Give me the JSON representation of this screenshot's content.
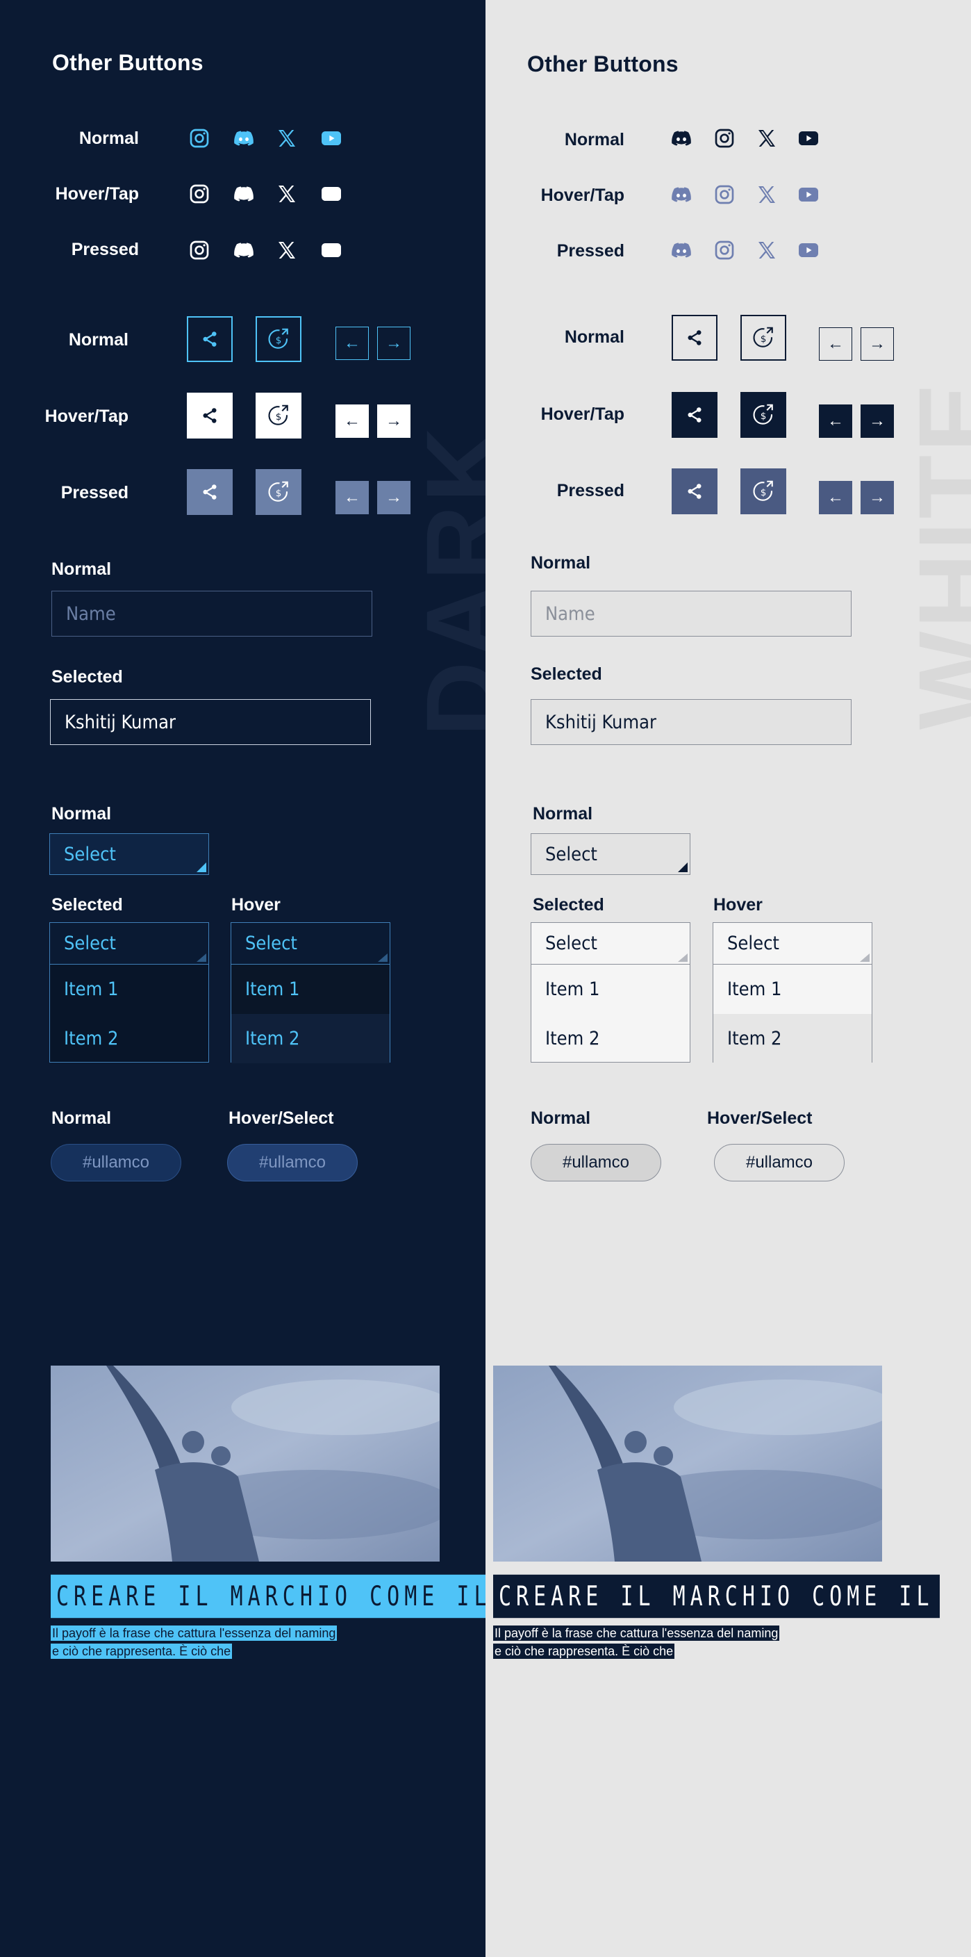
{
  "dark": {
    "watermark": "DARK",
    "title": "Other Buttons",
    "social_rows": [
      "Normal",
      "Hover/Tap",
      "Pressed"
    ],
    "action_rows": [
      "Normal",
      "Hover/Tap",
      "Pressed"
    ],
    "input_normal_label": "Normal",
    "input_placeholder": "Name",
    "input_selected_label": "Selected",
    "input_value": "Kshitij Kumar",
    "select_normal_label": "Normal",
    "select_text": "Select",
    "select_selected_label": "Selected",
    "select_hover_label": "Hover",
    "dropdown_items": [
      "Item 1",
      "Item 2"
    ],
    "chip_normal_label": "Normal",
    "chip_hover_label": "Hover/Select",
    "chip_text": "#ullamco",
    "headline": "CREARE IL MARCHIO COME IL",
    "paragraph_line1": "Il payoff è la frase che cattura l'essenza del naming",
    "paragraph_line2": "e ciò che rappresenta. È ciò che"
  },
  "light": {
    "watermark": "WHITE",
    "title": "Other Buttons",
    "social_rows": [
      "Normal",
      "Hover/Tap",
      "Pressed"
    ],
    "action_rows": [
      "Normal",
      "Hover/Tap",
      "Pressed"
    ],
    "input_normal_label": "Normal",
    "input_placeholder": "Name",
    "input_selected_label": "Selected",
    "input_value": "Kshitij Kumar",
    "select_normal_label": "Normal",
    "select_text": "Select",
    "select_selected_label": "Selected",
    "select_hover_label": "Hover",
    "dropdown_items": [
      "Item 1",
      "Item 2"
    ],
    "chip_normal_label": "Normal",
    "chip_hover_label": "Hover/Select",
    "chip_text": "#ullamco",
    "headline": "CREARE IL MARCHIO COME IL",
    "paragraph_line1": "Il payoff è la frase che cattura l'essenza del naming",
    "paragraph_line2": "e ciò che rappresenta. È ciò che"
  },
  "colors": {
    "dark_bg": "#0b1a33",
    "light_bg": "#e6e6e6",
    "accent_blue": "#4fc3f7",
    "pressed_dark": "#6b80a8",
    "pressed_light": "#4a5a82"
  },
  "icons": [
    "instagram-icon",
    "discord-icon",
    "x-icon",
    "youtube-icon",
    "share-icon",
    "dollar-refund-icon",
    "arrow-left-icon",
    "arrow-right-icon"
  ]
}
